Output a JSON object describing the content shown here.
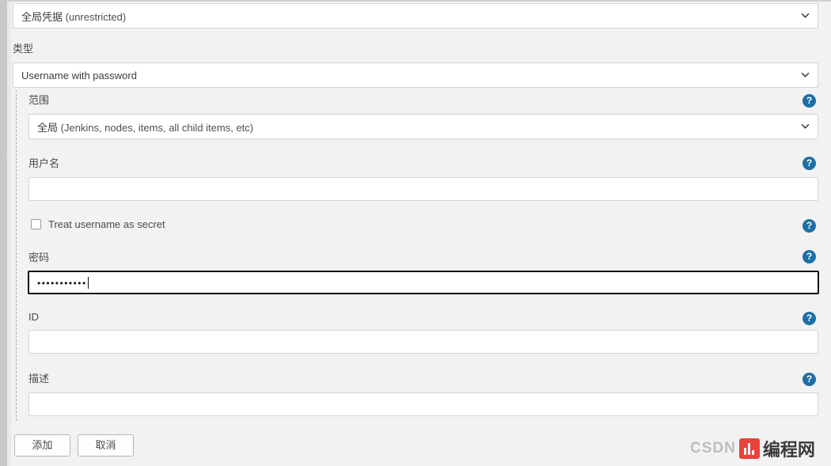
{
  "form": {
    "store_select": {
      "value_cn": "全局凭据",
      "value_en": "(unrestricted)",
      "icon": "chevron-down-icon"
    },
    "kind": {
      "label": "类型",
      "value": "Username with password",
      "icon": "chevron-down-icon"
    },
    "scope": {
      "label": "范围",
      "value_cn": "全局",
      "value_en": "(Jenkins, nodes, items, all child items, etc)",
      "icon": "chevron-down-icon",
      "help": "?"
    },
    "username": {
      "label": "用户名",
      "value": "",
      "help": "?"
    },
    "treat_username_as_secret": {
      "label": "Treat username as secret",
      "checked": false,
      "help": "?"
    },
    "password": {
      "label": "密码",
      "masked_value": "•••••••••••",
      "focused": true,
      "help": "?"
    },
    "id": {
      "label": "ID",
      "value": "",
      "help": "?"
    },
    "description": {
      "label": "描述",
      "value": "",
      "help": "?"
    }
  },
  "actions": {
    "add_label": "添加",
    "cancel_label": "取消"
  },
  "watermark": {
    "prefix": "CSDN",
    "brand": "编程网",
    "badge_color": "#e8352c"
  },
  "colors": {
    "page_bg": "#f2f2f2",
    "input_bg": "#ffffff",
    "input_border": "#d4d4d4",
    "help_blue": "#1d6fa5",
    "focus_ring": "#101010",
    "label_text": "#4a4a4a"
  }
}
